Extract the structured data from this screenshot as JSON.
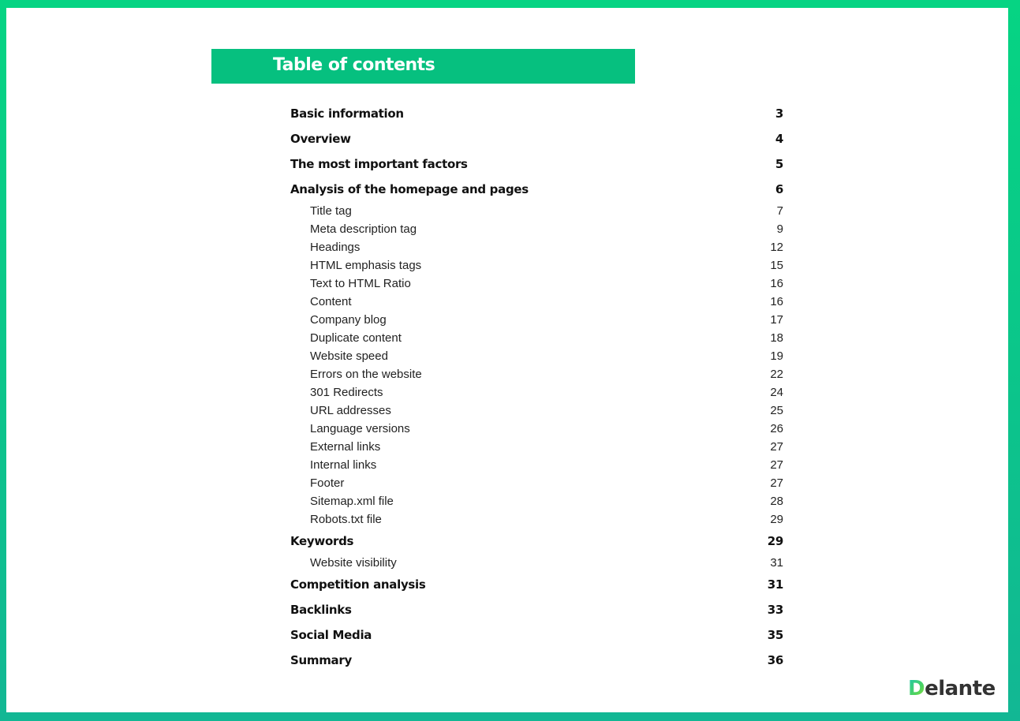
{
  "header": {
    "title": "Table of contents"
  },
  "toc": [
    {
      "label": "Basic information",
      "page": "3",
      "level": "main"
    },
    {
      "label": "Overview",
      "page": "4",
      "level": "main"
    },
    {
      "label": "The most important factors",
      "page": "5",
      "level": "main"
    },
    {
      "label": "Analysis of the homepage and pages",
      "page": "6",
      "level": "main"
    },
    {
      "label": "Title tag",
      "page": "7",
      "level": "sub"
    },
    {
      "label": "Meta description tag",
      "page": "9",
      "level": "sub"
    },
    {
      "label": "Headings",
      "page": "12",
      "level": "sub"
    },
    {
      "label": "HTML emphasis tags",
      "page": "15",
      "level": "sub"
    },
    {
      "label": "Text to HTML Ratio",
      "page": "16",
      "level": "sub"
    },
    {
      "label": "Content",
      "page": "16",
      "level": "sub"
    },
    {
      "label": "Company blog",
      "page": "17",
      "level": "sub"
    },
    {
      "label": "Duplicate content",
      "page": "18",
      "level": "sub"
    },
    {
      "label": "Website speed",
      "page": "19",
      "level": "sub"
    },
    {
      "label": "Errors on the website",
      "page": "22",
      "level": "sub"
    },
    {
      "label": "301 Redirects",
      "page": "24",
      "level": "sub"
    },
    {
      "label": "URL addresses",
      "page": "25",
      "level": "sub"
    },
    {
      "label": "Language versions",
      "page": "26",
      "level": "sub"
    },
    {
      "label": "External links",
      "page": "27",
      "level": "sub"
    },
    {
      "label": "Internal links",
      "page": "27",
      "level": "sub"
    },
    {
      "label": "Footer",
      "page": "27",
      "level": "sub"
    },
    {
      "label": "Sitemap.xml file",
      "page": "28",
      "level": "sub"
    },
    {
      "label": "Robots.txt file",
      "page": "29",
      "level": "sub"
    },
    {
      "label": "Keywords",
      "page": "29",
      "level": "main"
    },
    {
      "label": "Website visibility",
      "page": "31",
      "level": "sub"
    },
    {
      "label": "Competition analysis",
      "page": "31",
      "level": "main"
    },
    {
      "label": "Backlinks",
      "page": "33",
      "level": "main"
    },
    {
      "label": "Social Media",
      "page": "35",
      "level": "main"
    },
    {
      "label": "Summary",
      "page": "36",
      "level": "main"
    }
  ],
  "logo": {
    "first_letter": "D",
    "rest": "elante"
  },
  "colors": {
    "accent": "#06c07f",
    "frame_top": "#06d483",
    "frame_bottom": "#12b794"
  }
}
